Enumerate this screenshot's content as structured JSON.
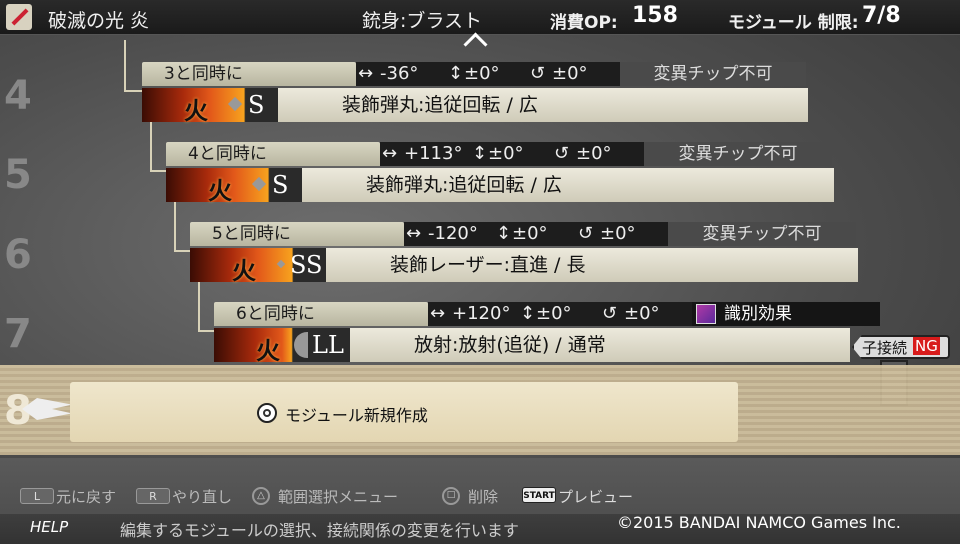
{
  "header": {
    "title": "破滅の光 炎",
    "barrel_label": "銃身:ブラスト",
    "op_label": "消費OP:",
    "op_value": "158",
    "module_label": "モジュール 制限:",
    "module_value": "7/8"
  },
  "row_numbers": [
    "4",
    "5",
    "6",
    "7",
    "8"
  ],
  "modules": [
    {
      "timing": "3と同時に",
      "angle_h": "-36°",
      "angle_v": "±0°",
      "rotation": "±0°",
      "tag": "変異チップ不可",
      "element": "火",
      "size": "S",
      "description": "装飾弾丸:追従回転 / 広"
    },
    {
      "timing": "4と同時に",
      "angle_h": "+113°",
      "angle_v": "±0°",
      "rotation": "±0°",
      "tag": "変異チップ不可",
      "element": "火",
      "size": "S",
      "description": "装飾弾丸:追従回転 / 広"
    },
    {
      "timing": "5と同時に",
      "angle_h": "-120°",
      "angle_v": "±0°",
      "rotation": "±0°",
      "tag": "変異チップ不可",
      "element": "火",
      "size": "SS",
      "description": "装飾レーザー:直進 / 長"
    },
    {
      "timing": "6と同時に",
      "angle_h": "+120°",
      "angle_v": "±0°",
      "rotation": "±0°",
      "tag": "識別効果",
      "element": "火",
      "size": "LL",
      "description": "放射:放射(追従) / 通常"
    }
  ],
  "new_module_label": "モジュール新規作成",
  "child_connection": {
    "label": "子接続",
    "status": "NG"
  },
  "controls": [
    {
      "key": "L",
      "label": "元に戻す"
    },
    {
      "key": "R",
      "label": "やり直し"
    },
    {
      "key": "△",
      "label": "範囲選択メニュー"
    },
    {
      "key": "□",
      "label": "削除"
    },
    {
      "key": "START",
      "label": "プレビュー"
    }
  ],
  "help": {
    "label": "HELP",
    "text": "編集するモジュールの選択、接続関係の変更を行います",
    "copyright": "©2015 BANDAI NAMCO Games Inc."
  }
}
